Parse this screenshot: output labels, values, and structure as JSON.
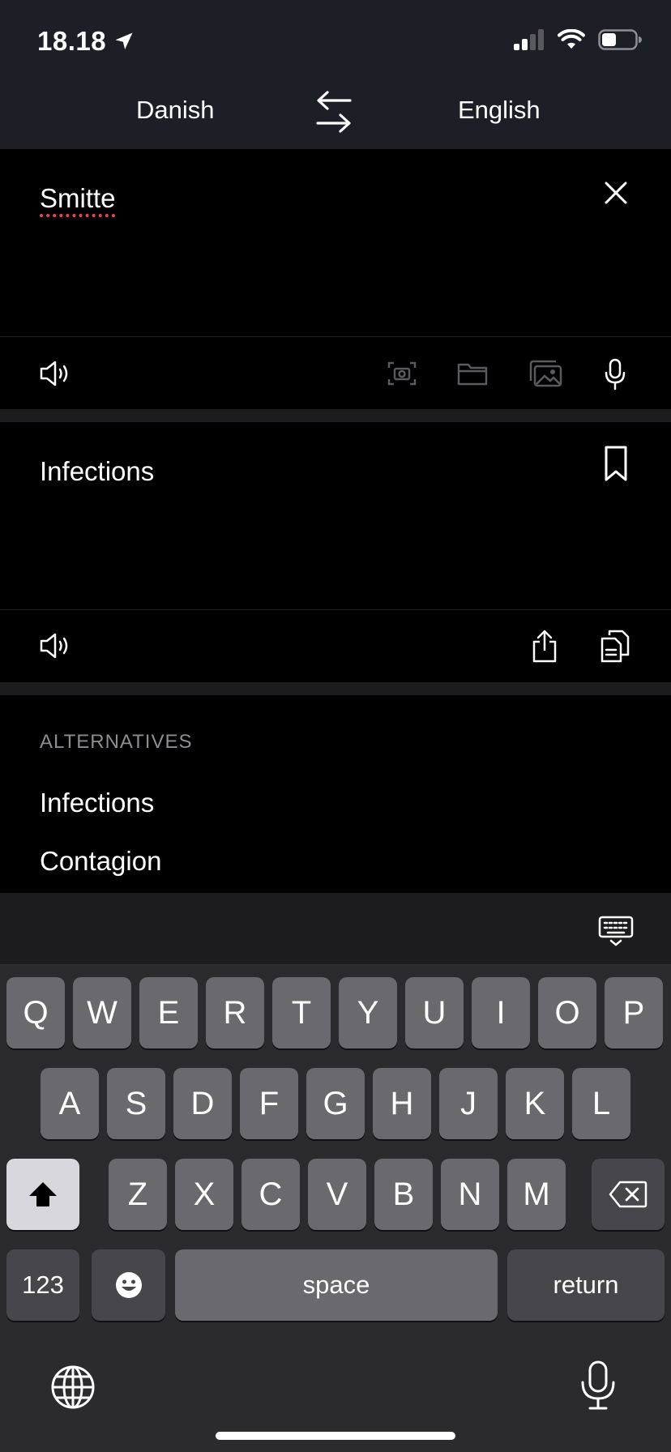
{
  "status": {
    "time": "18.18"
  },
  "languages": {
    "source": "Danish",
    "target": "English"
  },
  "source_panel": {
    "text": "Smitte"
  },
  "translation_panel": {
    "text": "Infections"
  },
  "alternatives": {
    "heading": "ALTERNATIVES",
    "items": [
      "Infections",
      "Contagion"
    ]
  },
  "keyboard": {
    "row1": [
      "Q",
      "W",
      "E",
      "R",
      "T",
      "Y",
      "U",
      "I",
      "O",
      "P"
    ],
    "row2": [
      "A",
      "S",
      "D",
      "F",
      "G",
      "H",
      "J",
      "K",
      "L"
    ],
    "row3": [
      "Z",
      "X",
      "C",
      "V",
      "B",
      "N",
      "M"
    ],
    "numbers_label": "123",
    "space_label": "space",
    "return_label": "return"
  },
  "icons": {
    "location": "location-arrow-icon",
    "signal": "signal-icon",
    "wifi": "wifi-icon",
    "battery": "battery-icon",
    "swap": "swap-languages-icon",
    "close": "close-icon",
    "speaker": "speaker-icon",
    "camera": "camera-scan-icon",
    "folder": "folder-icon",
    "photos": "photos-icon",
    "mic": "microphone-icon",
    "bookmark": "bookmark-icon",
    "share": "share-icon",
    "copy": "copy-icon",
    "keyboard": "keyboard-dismiss-icon",
    "shift": "shift-icon",
    "backspace": "backspace-icon",
    "emoji": "emoji-icon",
    "globe": "globe-icon"
  },
  "colors": {
    "topbar": "#1c1f26",
    "spell_underline": "#e5484d",
    "muted": "#8c8c93"
  }
}
